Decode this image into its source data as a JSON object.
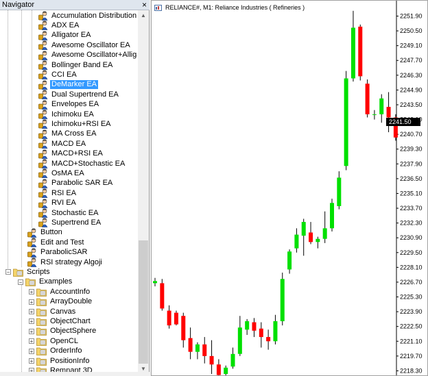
{
  "navigator": {
    "title": "Navigator",
    "close_glyph": "×",
    "expert_items": [
      {
        "label": "Accumulation Distribution EA"
      },
      {
        "label": "ADX EA"
      },
      {
        "label": "Alligator EA"
      },
      {
        "label": "Awesome Oscillator EA"
      },
      {
        "label": "Awesome Oscillator+Alligator EA"
      },
      {
        "label": "Bollinger Band EA"
      },
      {
        "label": "CCI EA"
      },
      {
        "label": "DeMarker EA",
        "selected": true
      },
      {
        "label": "Dual Supertrend EA"
      },
      {
        "label": "Envelopes EA"
      },
      {
        "label": "Ichimoku EA"
      },
      {
        "label": "Ichimoku+RSI EA"
      },
      {
        "label": "MA Cross EA"
      },
      {
        "label": "MACD EA"
      },
      {
        "label": "MACD+RSI EA"
      },
      {
        "label": "MACD+Stochastic EA"
      },
      {
        "label": "OsMA EA"
      },
      {
        "label": "Parabolic SAR EA"
      },
      {
        "label": "RSI EA"
      },
      {
        "label": "RVI EA"
      },
      {
        "label": "Stochastic EA"
      },
      {
        "label": "Supertrend EA"
      }
    ],
    "top_items": [
      {
        "label": "Button"
      },
      {
        "label": "Edit and Test"
      },
      {
        "label": "ParabolicSAR"
      },
      {
        "label": "RSI strategy Algoji"
      }
    ],
    "scripts": {
      "label": "Scripts",
      "examples": {
        "label": "Examples",
        "children": [
          {
            "label": "AccountInfo"
          },
          {
            "label": "ArrayDouble"
          },
          {
            "label": "Canvas"
          },
          {
            "label": "ObjectChart"
          },
          {
            "label": "ObjectSphere"
          },
          {
            "label": "OpenCL"
          },
          {
            "label": "OrderInfo"
          },
          {
            "label": "PositionInfo"
          },
          {
            "label": "Remnant 3D"
          }
        ]
      }
    },
    "expander_collapsed": "+",
    "expander_expanded": "−"
  },
  "chart": {
    "caption": "RELIANCE#, M1:  Reliance Industries ( Refineries )",
    "current_price": "2241.50",
    "colors": {
      "bull": "#00e000",
      "bear": "#ff0000",
      "wick": "#000000",
      "badge": "#000000"
    },
    "chart_data": {
      "type": "candlestick",
      "symbol": "RELIANCE#",
      "timeframe": "M1",
      "ylim": [
        2217.5,
        2252.3
      ],
      "y_ticks": [
        "2251.90",
        "2250.50",
        "2249.10",
        "2247.70",
        "2246.30",
        "2244.90",
        "2243.50",
        "2242.10",
        "2240.70",
        "2239.30",
        "2237.90",
        "2236.50",
        "2235.10",
        "2233.70",
        "2232.30",
        "2230.90",
        "2229.50",
        "2228.10",
        "2226.70",
        "2225.30",
        "2223.90",
        "2222.50",
        "2221.10",
        "2219.70",
        "2218.30"
      ],
      "candles": [
        {
          "o": 2226.6,
          "h": 2227.1,
          "l": 2226.3,
          "c": 2226.8
        },
        {
          "o": 2226.6,
          "h": 2227.0,
          "l": 2224.0,
          "c": 2224.2
        },
        {
          "o": 2224.0,
          "h": 2224.5,
          "l": 2222.3,
          "c": 2222.6
        },
        {
          "o": 2223.8,
          "h": 2224.0,
          "l": 2222.6,
          "c": 2222.7
        },
        {
          "o": 2223.5,
          "h": 2223.8,
          "l": 2220.5,
          "c": 2221.2
        },
        {
          "o": 2221.4,
          "h": 2222.4,
          "l": 2219.4,
          "c": 2220.1
        },
        {
          "o": 2220.1,
          "h": 2221.0,
          "l": 2219.4,
          "c": 2220.8
        },
        {
          "o": 2220.8,
          "h": 2221.5,
          "l": 2219.0,
          "c": 2219.7
        },
        {
          "o": 2219.7,
          "h": 2221.2,
          "l": 2218.0,
          "c": 2218.9
        },
        {
          "o": 2218.9,
          "h": 2219.4,
          "l": 2217.6,
          "c": 2217.9
        },
        {
          "o": 2218.0,
          "h": 2218.8,
          "l": 2217.6,
          "c": 2218.6
        },
        {
          "o": 2218.7,
          "h": 2220.5,
          "l": 2218.5,
          "c": 2219.9
        },
        {
          "o": 2219.9,
          "h": 2223.5,
          "l": 2219.7,
          "c": 2222.4
        },
        {
          "o": 2222.2,
          "h": 2223.2,
          "l": 2221.7,
          "c": 2223.0
        },
        {
          "o": 2222.9,
          "h": 2223.3,
          "l": 2221.5,
          "c": 2222.1
        },
        {
          "o": 2222.3,
          "h": 2222.9,
          "l": 2220.5,
          "c": 2221.5
        },
        {
          "o": 2221.5,
          "h": 2222.2,
          "l": 2220.3,
          "c": 2221.1
        },
        {
          "o": 2221.1,
          "h": 2223.6,
          "l": 2220.8,
          "c": 2223.0
        },
        {
          "o": 2223.0,
          "h": 2227.6,
          "l": 2222.6,
          "c": 2227.0
        },
        {
          "o": 2227.9,
          "h": 2229.8,
          "l": 2227.5,
          "c": 2229.6
        },
        {
          "o": 2229.9,
          "h": 2231.8,
          "l": 2229.5,
          "c": 2231.2
        },
        {
          "o": 2231.1,
          "h": 2232.7,
          "l": 2229.2,
          "c": 2232.4
        },
        {
          "o": 2231.4,
          "h": 2232.4,
          "l": 2230.3,
          "c": 2230.5
        },
        {
          "o": 2230.5,
          "h": 2231.0,
          "l": 2229.9,
          "c": 2230.8
        },
        {
          "o": 2230.8,
          "h": 2233.4,
          "l": 2230.4,
          "c": 2231.8
        },
        {
          "o": 2231.8,
          "h": 2234.6,
          "l": 2231.5,
          "c": 2234.2
        },
        {
          "o": 2233.9,
          "h": 2237.2,
          "l": 2233.6,
          "c": 2236.6
        },
        {
          "o": 2237.7,
          "h": 2246.7,
          "l": 2237.3,
          "c": 2246.0
        },
        {
          "o": 2246.0,
          "h": 2252.4,
          "l": 2245.7,
          "c": 2250.8
        },
        {
          "o": 2250.9,
          "h": 2251.1,
          "l": 2245.8,
          "c": 2246.2
        },
        {
          "o": 2245.5,
          "h": 2245.9,
          "l": 2242.3,
          "c": 2242.6
        },
        {
          "o": 2242.6,
          "h": 2243.0,
          "l": 2242.1,
          "c": 2242.6
        },
        {
          "o": 2242.6,
          "h": 2244.5,
          "l": 2241.8,
          "c": 2244.1
        },
        {
          "o": 2243.3,
          "h": 2244.7,
          "l": 2240.9,
          "c": 2242.3
        },
        {
          "o": 2242.3,
          "h": 2242.6,
          "l": 2240.1,
          "c": 2240.4
        },
        {
          "o": 2240.4,
          "h": 2241.3,
          "l": 2238.8,
          "c": 2241.4
        },
        {
          "o": 2241.4,
          "h": 2241.6,
          "l": 2240.0,
          "c": 2240.7
        }
      ]
    }
  }
}
